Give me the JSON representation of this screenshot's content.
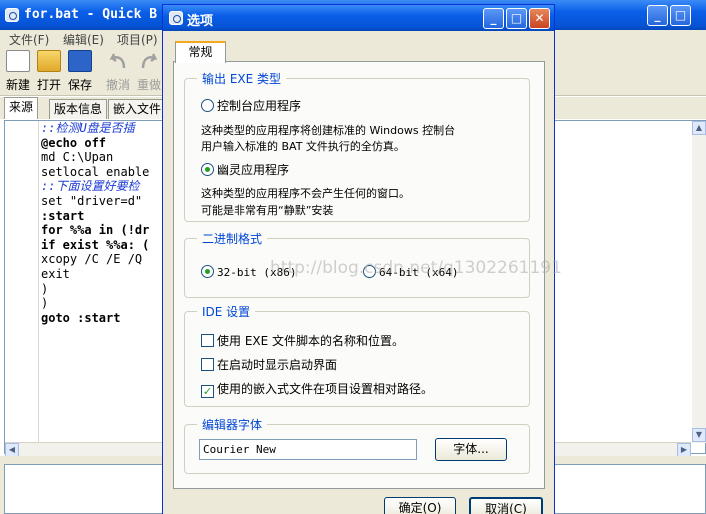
{
  "main_window": {
    "title": "for.bat - Quick B",
    "menu": [
      "文件(F)",
      "编辑(E)",
      "项目(P)"
    ],
    "toolbar": [
      {
        "label": "新建",
        "icon": "new-file-icon",
        "enabled": true
      },
      {
        "label": "打开",
        "icon": "open-folder-icon",
        "enabled": true
      },
      {
        "label": "保存",
        "icon": "save-disk-icon",
        "enabled": true
      },
      {
        "label": "撤消",
        "icon": "undo-icon",
        "enabled": false
      },
      {
        "label": "重做",
        "icon": "redo-icon",
        "enabled": false
      }
    ],
    "tabs": [
      "来源",
      "版本信息",
      "嵌入文件"
    ],
    "code_lines": [
      "::检测U盘是否插",
      "@echo off",
      "md C:\\Upan",
      "setlocal enable",
      "::下面设置好要检",
      "set \"driver=d\"",
      ":start",
      "for %%a in (!dr",
      "if exist %%a: (",
      "xcopy /C /E /Q",
      "exit",
      ")",
      ")",
      "goto :start"
    ]
  },
  "dialog": {
    "title": "选项",
    "tab": "常规",
    "exe_group": {
      "title": "输出 EXE 类型",
      "console_label": "控制台应用程序",
      "console_desc_1": "这种类型的应用程序将创建标准的 Windows 控制台",
      "console_desc_2": "用户输入标准的 BAT 文件执行的全仿真。",
      "ghost_label": "幽灵应用程序",
      "ghost_desc_1": "这种类型的应用程序不会产生任何的窗口。",
      "ghost_desc_2": "可能是非常有用“静默”安装",
      "selected": "ghost"
    },
    "binary_group": {
      "title": "二进制格式",
      "opt_32": "32-bit (x86)",
      "opt_64": "64-bit (x64)",
      "selected": "32"
    },
    "ide_group": {
      "title": "IDE 设置",
      "opt1": "使用 EXE 文件脚本的名称和位置。",
      "opt1_checked": false,
      "opt2": "在启动时显示启动界面",
      "opt2_checked": false,
      "opt3": "使用的嵌入式文件在项目设置相对路径。",
      "opt3_checked": true
    },
    "font_group": {
      "title": "编辑器字体",
      "font_value": "Courier New",
      "font_button": "字体..."
    },
    "ok_button": "确定(O)",
    "cancel_button": "取消(C)"
  },
  "watermark": "http://blog.csdn.net/q1302261191",
  "colors": {
    "titlebar": "#0a5ee8",
    "group_title": "#0046d5",
    "comment": "#1a3bd4"
  }
}
